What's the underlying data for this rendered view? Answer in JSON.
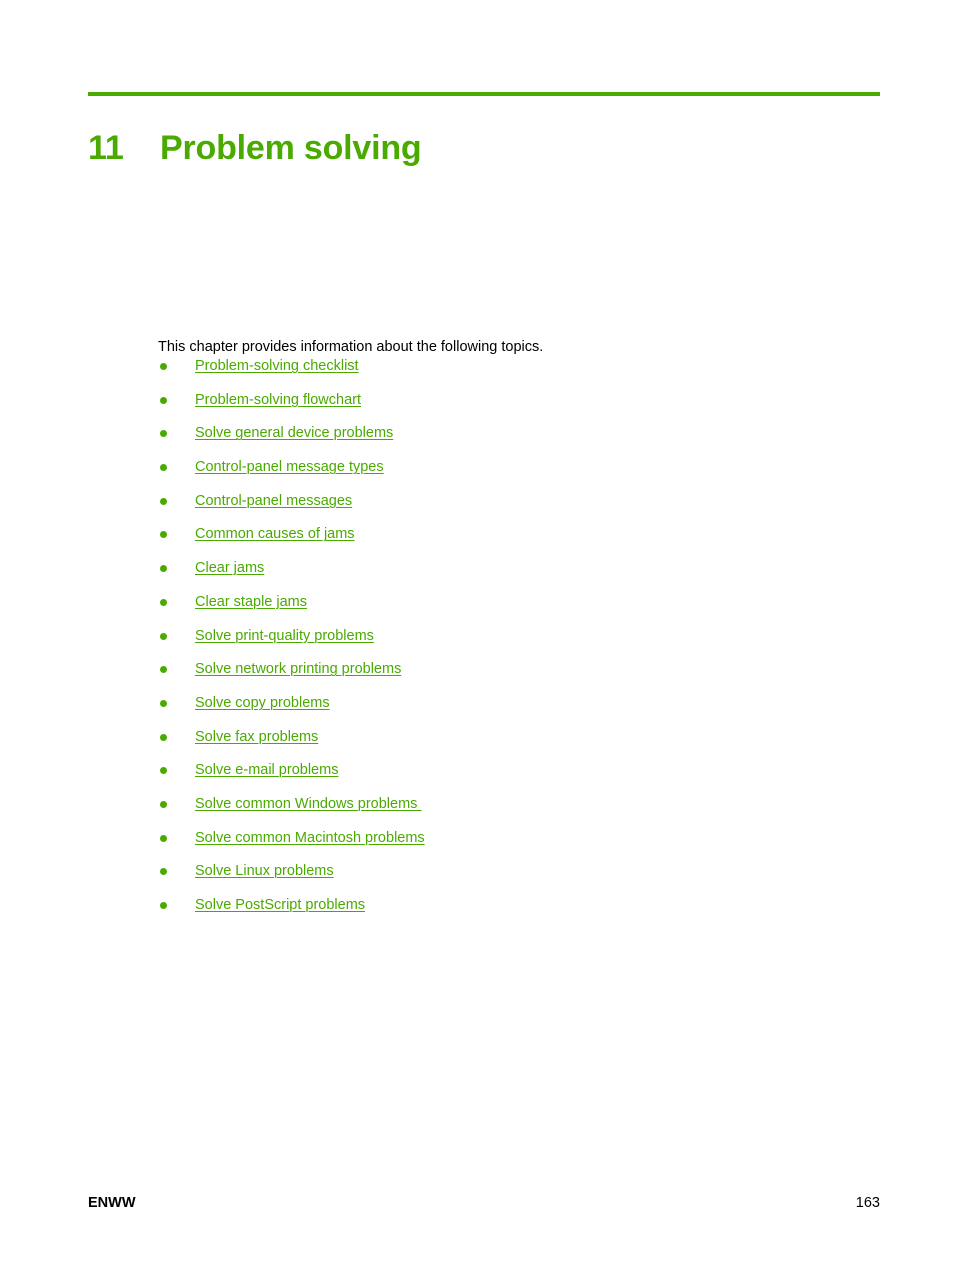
{
  "document": {
    "page_background": "#ffffff",
    "accent_color": "#4aaa00",
    "text_color": "#000000"
  },
  "chapter": {
    "number": "11",
    "title": "Problem solving"
  },
  "body": {
    "intro": "This chapter provides information about the following topics."
  },
  "topics": [
    {
      "label": "Problem-solving checklist"
    },
    {
      "label": "Problem-solving flowchart"
    },
    {
      "label": "Solve general device problems"
    },
    {
      "label": "Control-panel message types"
    },
    {
      "label": "Control-panel messages"
    },
    {
      "label": "Common causes of jams"
    },
    {
      "label": "Clear jams"
    },
    {
      "label": "Clear staple jams"
    },
    {
      "label": "Solve print-quality problems"
    },
    {
      "label": "Solve network printing problems"
    },
    {
      "label": "Solve copy problems"
    },
    {
      "label": "Solve fax problems"
    },
    {
      "label": "Solve e-mail problems"
    },
    {
      "label": "Solve common Windows problems "
    },
    {
      "label": "Solve common Macintosh problems"
    },
    {
      "label": "Solve Linux problems"
    },
    {
      "label": "Solve PostScript problems"
    }
  ],
  "footer": {
    "locale": "ENWW",
    "page_number": "163"
  }
}
